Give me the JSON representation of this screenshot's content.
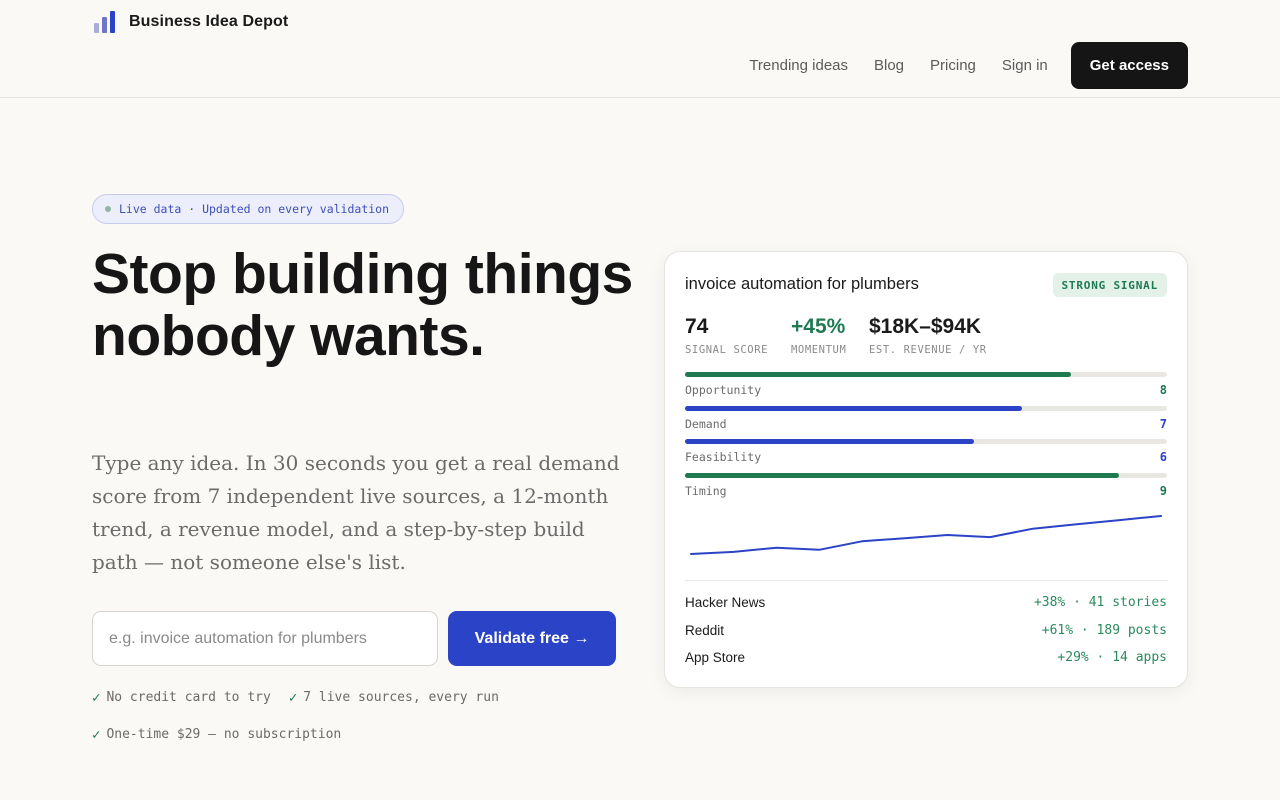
{
  "brand": {
    "name": "Business Idea Depot",
    "logo_colors": [
      "#a7acd8",
      "#6d76c9",
      "#2b43c7"
    ]
  },
  "nav": {
    "links": [
      "Trending ideas",
      "Blog",
      "Pricing",
      "Sign in"
    ],
    "cta_label": "Get access"
  },
  "hero": {
    "badge": "Live data · Updated on every validation",
    "headline": "Stop building things nobody wants.",
    "lede": "Type any idea. In 30 seconds you get a real demand score from 7 independent live sources, a 12-month trend, a revenue model, and a step-by-step build path — not someone else's list.",
    "input_placeholder": "e.g. invoice automation for plumbers",
    "button_label": "Validate free →",
    "perks": [
      "No credit card to try",
      "7 live sources, every run",
      "One-time $29 — no subscription"
    ]
  },
  "card": {
    "title": "invoice automation for plumbers",
    "signal_badge": "STRONG SIGNAL",
    "stats": [
      {
        "value": "74",
        "label": "SIGNAL SCORE",
        "color": "#1a1a1a"
      },
      {
        "value": "+45%",
        "label": "MOMENTUM",
        "color": "#1f7a52"
      },
      {
        "value": "$18K–$94K",
        "label": "EST. REVENUE / YR",
        "color": "#1a1a1a"
      }
    ],
    "metrics": [
      {
        "label": "Opportunity",
        "score": "8",
        "level": 0.8,
        "color": "#1f7a52"
      },
      {
        "label": "Demand",
        "score": "7",
        "level": 0.7,
        "color": "#2b43c7"
      },
      {
        "label": "Feasibility",
        "score": "6",
        "level": 0.6,
        "color": "#2b43c7"
      },
      {
        "label": "Timing",
        "score": "9",
        "level": 0.9,
        "color": "#1f7a52"
      }
    ],
    "trend": [
      12,
      14,
      18,
      16,
      24,
      27,
      30,
      28,
      36,
      40,
      44,
      48
    ],
    "trend_color": "#2b43c7",
    "sources": [
      {
        "name": "Hacker News",
        "stat": "+38% · 41 stories"
      },
      {
        "name": "Reddit",
        "stat": "+61% · 189 posts"
      },
      {
        "name": "App Store",
        "stat": "+29% · 14 apps"
      }
    ]
  }
}
